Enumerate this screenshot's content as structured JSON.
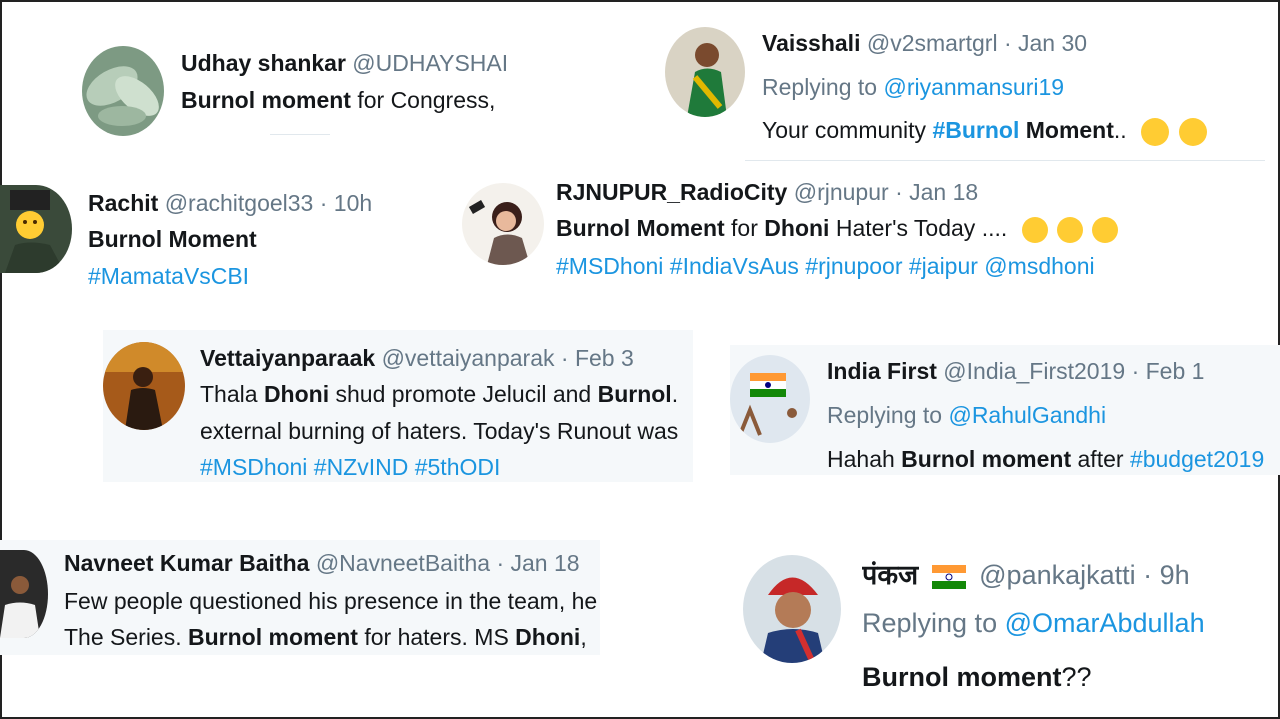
{
  "tweets": {
    "udhay": {
      "name": "Udhay shankar",
      "handle": "@UDHAYSHAI",
      "text_bold": "Burnol moment",
      "text_rest": " for Congress,"
    },
    "vaisshali": {
      "name": "Vaisshali",
      "handle": "@v2smartgrl",
      "date": "· Jan 30",
      "reply_prefix": "Replying to ",
      "reply_to": "@riyanmansuri19",
      "text_plain": "Your community ",
      "text_tag": "#Burnol",
      "text_bold": " Moment",
      "text_end": ".."
    },
    "rachit": {
      "name": "Rachit",
      "handle": "@rachitgoel33",
      "date": "· 10h",
      "text_bold": "Burnol Moment",
      "tag": "#MamataVsCBI"
    },
    "rjnupur": {
      "name": "RJNUPUR_RadioCity",
      "handle": "@rjnupur",
      "date": "· Jan 18",
      "text_b1": "Burnol Moment",
      "text_p1": " for ",
      "text_b2": "Dhoni",
      "text_p2": " Hater's Today ....",
      "tags": "#MSDhoni #IndiaVsAus #rjnupoor #jaipur @msdhoni"
    },
    "vettai": {
      "name": "Vettaiyanparaak",
      "handle": "@vettaiyanparak",
      "date": "· Feb 3",
      "l1_p1": "Thala ",
      "l1_b1": "Dhoni",
      "l1_p2": " shud promote Jelucil and ",
      "l1_b2": "Burnol",
      "l1_p3": ".",
      "line2": "external burning of haters. Today's Runout was",
      "tags": "#MSDhoni #NZvIND #5thODI"
    },
    "indiafirst": {
      "name": "India First",
      "handle": "@India_First2019",
      "date": "· Feb 1",
      "reply_prefix": "Replying to ",
      "reply_to": "@RahulGandhi",
      "text_p1": "Hahah ",
      "text_b1": "Burnol moment",
      "text_p2": " after ",
      "text_tag": "#budget2019"
    },
    "navneet": {
      "name": "Navneet Kumar Baitha",
      "handle": "@NavneetBaitha",
      "date": "· Jan 18",
      "line1": "Few people questioned his presence in the team, he",
      "l2_p1": "The Series. ",
      "l2_b1": "Burnol moment",
      "l2_p2": " for haters. MS ",
      "l2_b2": "Dhoni",
      "l2_p3": ","
    },
    "pankaj": {
      "name": "पंकज",
      "handle": "@pankajkatti",
      "date": "· 9h",
      "reply_prefix": "Replying to ",
      "reply_to": "@OmarAbdullah",
      "text_bold": "Burnol moment",
      "text_end": "??"
    }
  },
  "icons": [
    "avatar-leaf-icon",
    "avatar-woman-icon",
    "avatar-emoji-face-icon",
    "avatar-selfie-icon",
    "avatar-movie-icon",
    "avatar-flag-runner-icon",
    "avatar-man-icon",
    "avatar-turban-icon",
    "crazy-face-emoji-icon",
    "grin-emoji-icon",
    "hug-emoji-icon",
    "laugh-cry-emoji-icon",
    "india-flag-icon"
  ],
  "colors": {
    "link": "#1b95e0",
    "muted": "#657786",
    "text": "#14171a",
    "shade": "#f5f8fa"
  }
}
